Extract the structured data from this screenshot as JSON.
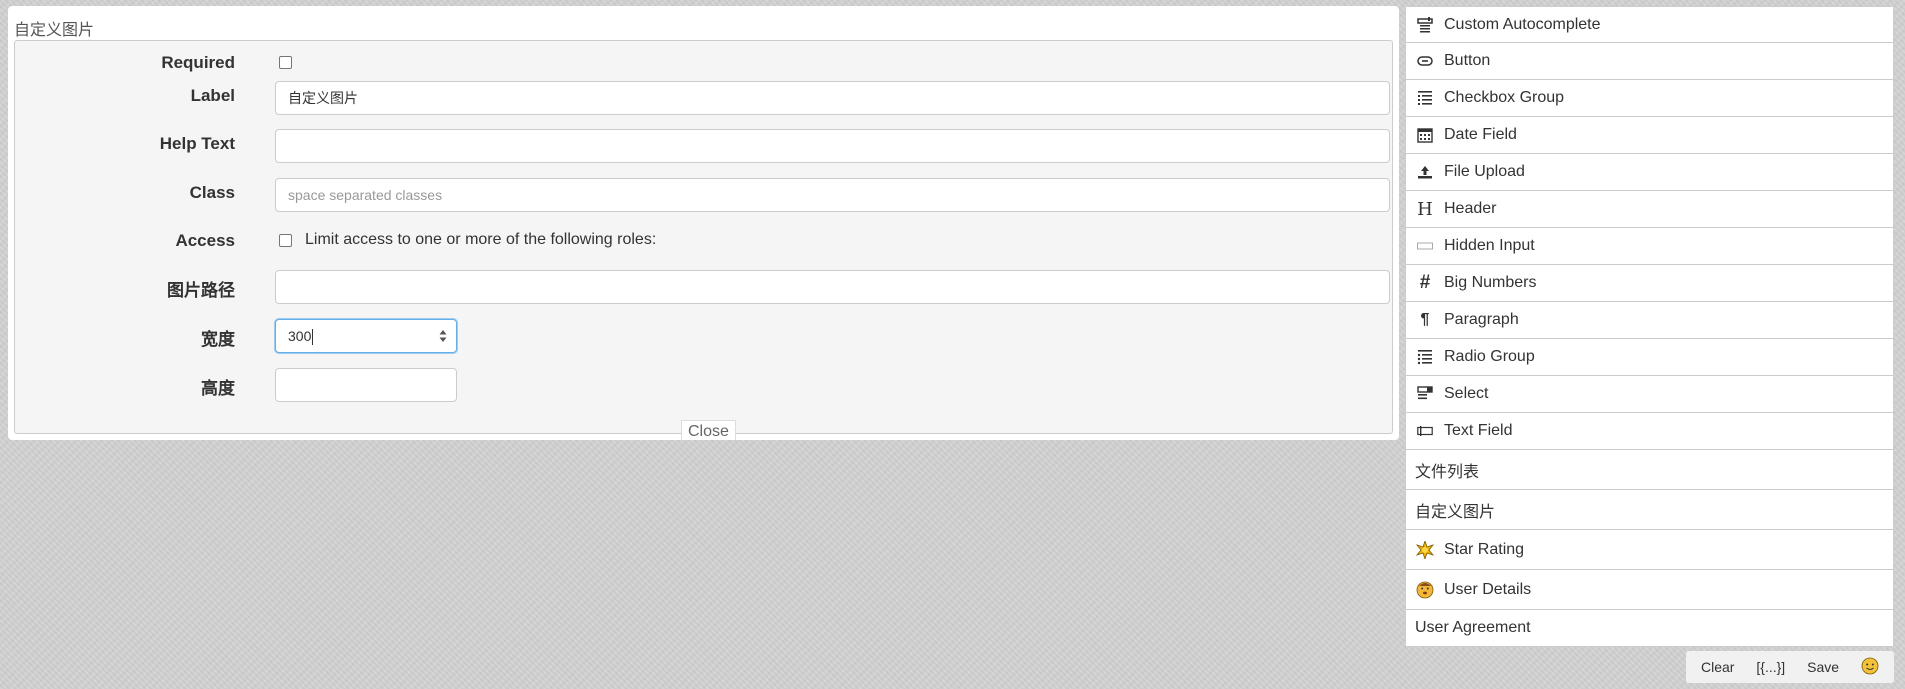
{
  "stage": {
    "field_title": "自定义图片",
    "labels": {
      "required": "Required",
      "label": "Label",
      "help_text": "Help Text",
      "class": "Class",
      "access": "Access",
      "image_path": "图片路径",
      "width": "宽度",
      "height": "高度"
    },
    "fields": {
      "label_value": "自定义图片",
      "help_text_value": "",
      "class_value": "",
      "class_placeholder": "space separated classes",
      "image_path_value": "",
      "width_value": "300",
      "height_value": ""
    },
    "required_checked": false,
    "access_checked": false,
    "access_text": "Limit access to one or more of the following roles:",
    "close_label": "Close"
  },
  "palette": {
    "items": [
      {
        "label": "Custom Autocomplete",
        "icon": "autocomplete-icon"
      },
      {
        "label": "Button",
        "icon": "button-icon"
      },
      {
        "label": "Checkbox Group",
        "icon": "checkbox-group-icon"
      },
      {
        "label": "Date Field",
        "icon": "calendar-icon"
      },
      {
        "label": "File Upload",
        "icon": "upload-icon"
      },
      {
        "label": "Header",
        "icon": "header-icon"
      },
      {
        "label": "Hidden Input",
        "icon": "hidden-input-icon"
      },
      {
        "label": "Big Numbers",
        "icon": "hash-icon"
      },
      {
        "label": "Paragraph",
        "icon": "paragraph-icon"
      },
      {
        "label": "Radio Group",
        "icon": "radio-group-icon"
      },
      {
        "label": "Select",
        "icon": "select-icon"
      },
      {
        "label": "Text Field",
        "icon": "text-field-icon"
      },
      {
        "label": "文件列表",
        "icon": ""
      },
      {
        "label": "自定义图片",
        "icon": ""
      },
      {
        "label": "Star Rating",
        "icon": "star-emoji-icon"
      },
      {
        "label": "User Details",
        "icon": "user-emoji-icon"
      },
      {
        "label": "User Agreement",
        "icon": ""
      }
    ]
  },
  "actions": {
    "clear": "Clear",
    "data": "[{...}]",
    "save": "Save",
    "emoji_icon": "smiley-icon"
  },
  "colors": {
    "background": "#d2d2d2",
    "panel": "#f5f5f5",
    "focus_border": "#66afe9"
  }
}
